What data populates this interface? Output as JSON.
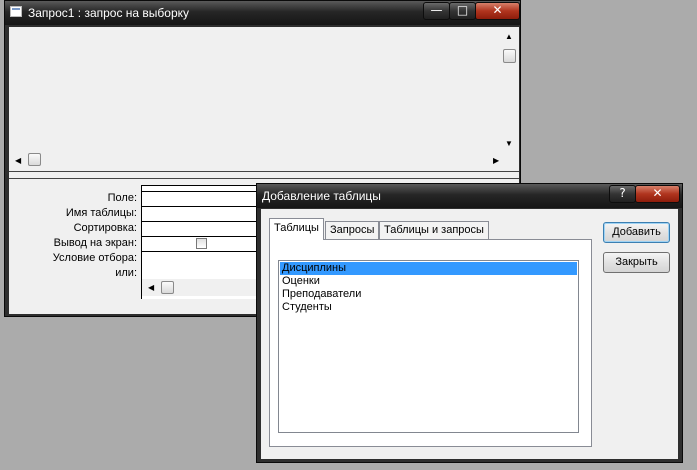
{
  "query_window": {
    "title": "Запрос1 : запрос на выборку",
    "controls": {
      "minimize": "—",
      "maximize": "□",
      "close": "✕"
    },
    "grid_labels": [
      "Поле:",
      "Имя таблицы:",
      "Сортировка:",
      "Вывод на экран:",
      "Условие отбора:",
      "или:"
    ]
  },
  "dialog": {
    "title": "Добавление таблицы",
    "help": "?",
    "close": "✕",
    "tabs": [
      {
        "label": "Таблицы",
        "active": true
      },
      {
        "label": "Запросы",
        "active": false
      },
      {
        "label": "Таблицы и запросы",
        "active": false
      }
    ],
    "tables": [
      "Дисциплины",
      "Оценки",
      "Преподаватели",
      "Студенты"
    ],
    "selected_table": "Дисциплины",
    "add_button": "Добавить",
    "close_button": "Закрыть"
  }
}
